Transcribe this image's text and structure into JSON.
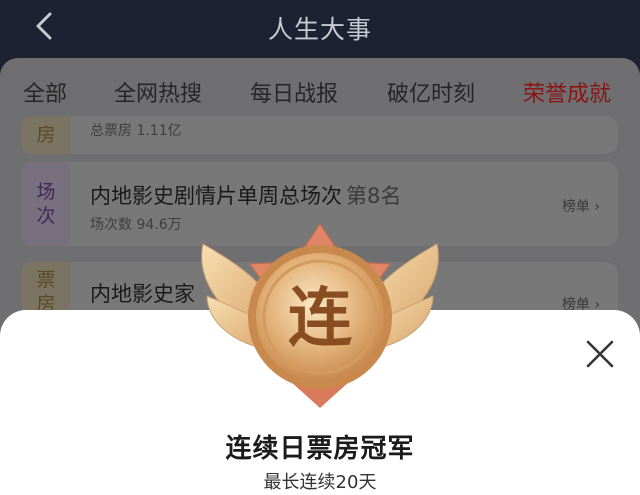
{
  "header": {
    "title": "人生大事",
    "back_icon": "chevron-left-icon"
  },
  "tabs": [
    {
      "label": "全部"
    },
    {
      "label": "全网热搜"
    },
    {
      "label": "每日战报"
    },
    {
      "label": "破亿时刻"
    },
    {
      "label": "荣誉成就",
      "active": true
    }
  ],
  "cards": [
    {
      "tag": "房",
      "sub": "总票房 1.11亿"
    },
    {
      "tag_line1": "场",
      "tag_line2": "次",
      "title": "内地影史剧情片单周总场次",
      "rank": "第8名",
      "sub": "场次数 94.6万",
      "link": "榜单"
    },
    {
      "tag_line1": "票",
      "tag_line2": "房",
      "title": "内地影史家",
      "link": "榜单"
    }
  ],
  "sheet": {
    "medal_char": "连",
    "title": "连续日票房冠军",
    "subtitle": "最长连续20天",
    "close_icon": "close-icon"
  },
  "colors": {
    "active_tab": "#d01f1f",
    "header_bg": "#1d2233"
  }
}
